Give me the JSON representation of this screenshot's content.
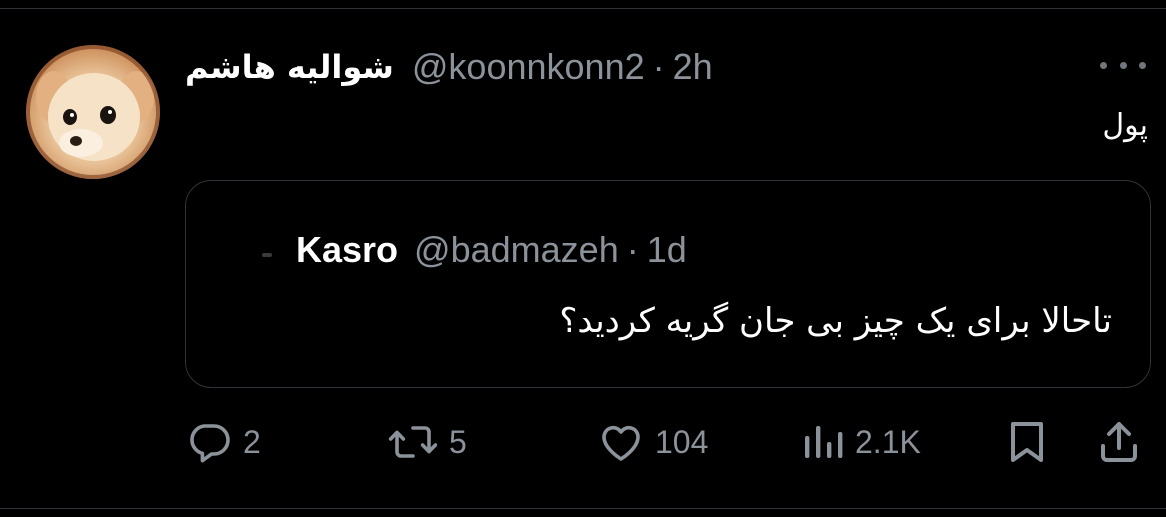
{
  "tweet": {
    "author": {
      "display_name": "شوالیه هاشم",
      "handle": "@koonnkonn2",
      "separator": "·",
      "time": "2h"
    },
    "text": "پول",
    "quote": {
      "author": {
        "display_name": "Kasro",
        "handle": "@badmazeh",
        "separator": "·",
        "time": "1d"
      },
      "text": "تاحالا برای یک چیز بی جان گریه کردید؟"
    },
    "actions": {
      "replies": "2",
      "retweets": "5",
      "likes": "104",
      "views": "2.1K"
    }
  },
  "colors": {
    "background": "#000000",
    "text_primary": "#ffffff",
    "text_secondary": "#8b9299",
    "border": "#2f3336"
  },
  "icons": {
    "more": "more-icon",
    "reply": "reply-icon",
    "retweet": "retweet-icon",
    "like": "heart-icon",
    "views": "views-icon",
    "bookmark": "bookmark-icon",
    "share": "share-icon"
  }
}
